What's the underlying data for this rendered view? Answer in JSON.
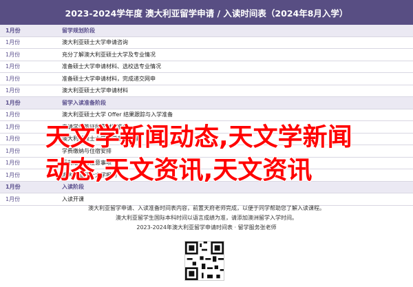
{
  "header": {
    "title": "2023-2024学年度 澳大利亚留学申请 / 入读时间表（2024年8月入学）"
  },
  "rows": [
    {
      "date": "1月份",
      "text": "留学规划阶段",
      "phase": true
    },
    {
      "date": "1月份",
      "text": "澳大利亚硕士大学申请咨询",
      "phase": false
    },
    {
      "date": "1月份",
      "text": "充分了解澳大利亚硕士大学及专业情况",
      "phase": false
    },
    {
      "date": "1月份",
      "text": "准备硕士大学申请材料、选校选专业情况",
      "phase": false
    },
    {
      "date": "1月份",
      "text": "准备硕士大学申请材料，完成递交网申",
      "phase": false
    },
    {
      "date": "1月份",
      "text": "澳大利亚硕士大学申请材料",
      "phase": false
    },
    {
      "date": "1月份",
      "text": "留学入读准备阶段",
      "phase": true
    },
    {
      "date": "1月份",
      "text": "澳大利亚硕士大学 Offer 结果跟踪与入学准备",
      "phase": false
    },
    {
      "date": "1月份",
      "text": "申请学生签证所需材料准备",
      "phase": false
    },
    {
      "date": "1月份",
      "text": "澳大利亚硕士大学入学手续办理",
      "phase": false
    },
    {
      "date": "1月份",
      "text": "学费缴纳与住宿安排",
      "phase": false
    },
    {
      "date": "1月份",
      "text": "行前准备与注意事项",
      "phase": false
    },
    {
      "date": "1月份",
      "text": "澳大利亚硕士大学报到",
      "phase": false
    },
    {
      "date": "1月份",
      "text": "入读阶段",
      "phase": true
    },
    {
      "date": "1月份",
      "text": "入读开课",
      "phase": false
    }
  ],
  "footer": {
    "line1": "澳大利亚留学申请、入读准备时间表内容，前置天府老师完成，以便于同学帮助您了解入读课程。",
    "line2": "澳大利亚留学生国际本科时间以语言成绩为准，请添加澳洲留学入学时间。",
    "line3": "2023-2024年澳大利亚留学申请时间表 · 留学服务张老师"
  },
  "overlay": {
    "line1": "天文学新闻动态,天文学新闻",
    "line2": "动态,天文资讯,天文资讯"
  },
  "qr": {
    "icon": "qr-code-icon"
  }
}
